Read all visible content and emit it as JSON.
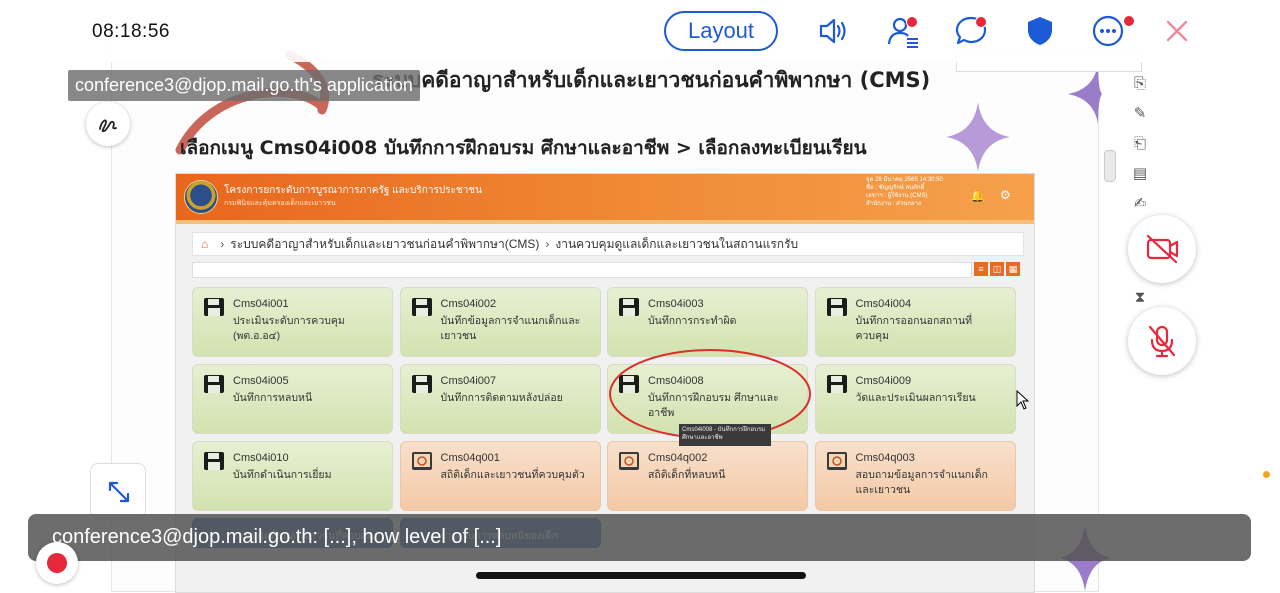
{
  "top_bar": {
    "clock": "08:18:56",
    "layout_label": "Layout",
    "accent": "#1d5bd6",
    "icons": [
      "speaker-icon",
      "participants-icon",
      "chat-icon",
      "shield-icon",
      "more-icon",
      "close-icon"
    ],
    "notification_color": "#e5283b"
  },
  "share": {
    "app_label": "conference3@djop.mail.go.th's application"
  },
  "slide": {
    "title": "ระบบคดีอาญาสำหรับเด็กและเยาวชนก่อนคำพิพากษา (CMS)",
    "subtitle": "เลือกเมนู Cms04i008 บันทึกการฝึกอบรม ศึกษาและอาชีพ > เลือกลงทะเบียนเรียน"
  },
  "cms": {
    "org_name": "โครงการยกระดับการบูรณาการภาครัฐ และบริการประชาชน",
    "org_sub": "กรมพินิจและคุ้มครองเด็กและเยาวชน",
    "user_info": [
      "จุด 28 มีนาคม 2565 14:30:50",
      "ชื่อ : ชัญญรักษ์ ลบภักดิ์",
      "เลขาฯ : ผู้ใช้งาน (CMS)",
      "สำนักงาน : ส่วนกลาง"
    ],
    "breadcrumb": [
      "ระบบคดีอาญาสำหรับเด็กและเยาวชนก่อนคำพิพากษา(CMS)",
      "งานควบคุมดูแลเด็กและเยาวชนในสถานแรกรับ"
    ],
    "header_color": "#e8661c",
    "tiles": [
      {
        "code": "Cms04i001",
        "label": "ประเมินระดับการควบคุม (พต.อ.อ๔)",
        "style": "green",
        "icon": "floppy-icon"
      },
      {
        "code": "Cms04i002",
        "label": "บันทึกข้อมูลการจำแนกเด็กและเยาวชน",
        "style": "green",
        "icon": "floppy-icon"
      },
      {
        "code": "Cms04i003",
        "label": "บันทึกการกระทำผิด",
        "style": "green",
        "icon": "floppy-icon"
      },
      {
        "code": "Cms04i004",
        "label": "บันทึกการออกนอกสถานที่ควบคุม",
        "style": "green",
        "icon": "floppy-icon"
      },
      {
        "code": "Cms04i005",
        "label": "บันทึกการหลบหนี",
        "style": "green",
        "icon": "floppy-icon"
      },
      {
        "code": "Cms04i007",
        "label": "บันทึกการติดตามหลังปล่อย",
        "style": "green",
        "icon": "floppy-icon"
      },
      {
        "code": "Cms04i008",
        "label": "บันทึกการฝึกอบรม ศึกษาและอาชีพ",
        "style": "green",
        "icon": "floppy-icon"
      },
      {
        "code": "Cms04i009",
        "label": "วัดและประเมินผลการเรียน",
        "style": "green",
        "icon": "floppy-icon"
      },
      {
        "code": "Cms04i010",
        "label": "บันทึกดำเนินการเยี่ยม",
        "style": "green",
        "icon": "floppy-icon"
      },
      {
        "code": "Cms04q001",
        "label": "สถิติเด็กและเยาวชนที่ควบคุมตัว",
        "style": "orange",
        "icon": "report-icon"
      },
      {
        "code": "Cms04q002",
        "label": "สถิติเด็กที่หลบหนี",
        "style": "orange",
        "icon": "report-icon"
      },
      {
        "code": "Cms04q003",
        "label": "สอบถามข้อมูลการจำแนกเด็กและเยาวชน",
        "style": "orange",
        "icon": "report-icon"
      }
    ],
    "bottom_row": [
      "รายงานเด็กและเยาวชนที่ควบคุม",
      "รายงานการหลบหนีของเด็ก"
    ],
    "tooltip": "Cms04i008 - บันทึกการฝึกอบรม ศึกษาและอาชีพ"
  },
  "caption": {
    "text": "conference3@djop.mail.go.th: [...], how level of [...]"
  }
}
